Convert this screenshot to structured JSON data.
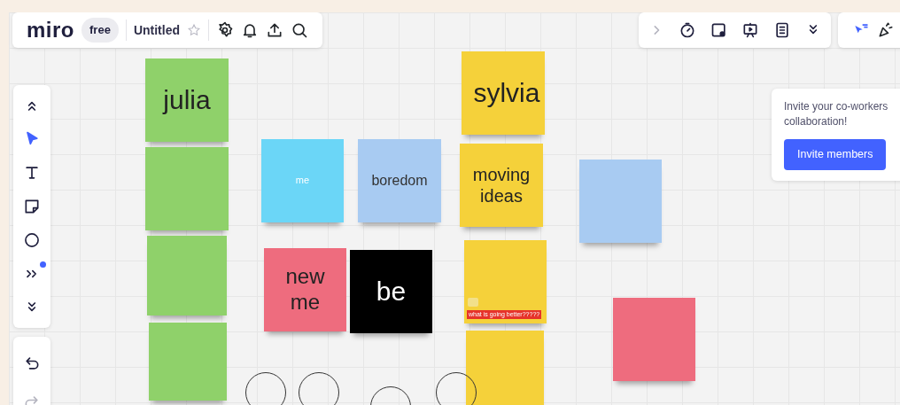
{
  "header": {
    "logo": "miro",
    "plan": "free",
    "board_title": "Untitled",
    "starred": false
  },
  "left_tools": [
    {
      "kind": "collapse",
      "selected": false
    },
    {
      "kind": "select",
      "selected": true
    },
    {
      "kind": "text",
      "selected": false
    },
    {
      "kind": "sticky",
      "selected": false
    },
    {
      "kind": "shape",
      "selected": false
    },
    {
      "kind": "more",
      "selected": false,
      "notification": true
    },
    {
      "kind": "expand",
      "selected": false
    }
  ],
  "history_tools": [
    {
      "kind": "undo",
      "disabled": false
    },
    {
      "kind": "redo",
      "disabled": true
    }
  ],
  "right_tools": [
    {
      "kind": "chevron"
    },
    {
      "kind": "timer"
    },
    {
      "kind": "card"
    },
    {
      "kind": "present"
    },
    {
      "kind": "notes"
    },
    {
      "kind": "expand"
    }
  ],
  "stickies": [
    {
      "text": "julia",
      "color": "#8fd16a"
    },
    {
      "color": "#8fd16a"
    },
    {
      "color": "#8fd16a"
    },
    {
      "color": "#8fd16a"
    },
    {
      "text": "me",
      "color": "#6bd6f7"
    },
    {
      "text": "boredom",
      "color": "#a8cbf2"
    },
    {
      "text": "new me",
      "color": "#ee6c7e"
    },
    {
      "text": "be",
      "color": "#000000"
    },
    {
      "text": "sylvia",
      "color": "#f5d13a"
    },
    {
      "text": "moving ideas",
      "color": "#f5d13a"
    },
    {
      "color": "#f5d13a",
      "tag": "what is going better?????"
    },
    {
      "color": "#f5d13a"
    },
    {
      "color": "#a8cbf2"
    },
    {
      "color": "#ee6c7e"
    }
  ],
  "invite": {
    "lines": [
      "Invite your co-workers",
      "collaboration!"
    ],
    "button": "Invite members"
  }
}
